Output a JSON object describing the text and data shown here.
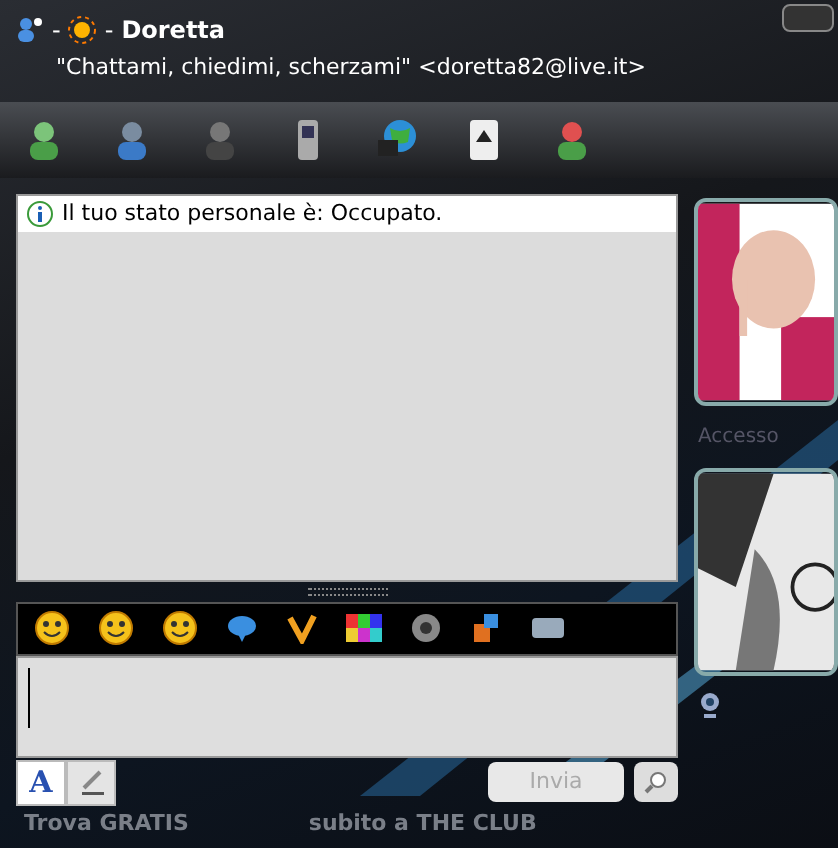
{
  "header": {
    "separator_1": "-",
    "separator_2": "-",
    "name": "Doretta",
    "personal_message": "\"Chattami, chiedimi, scherzami\" <doretta82@live.it>"
  },
  "chat": {
    "status_message": "Il tuo stato personale è: Occupato."
  },
  "compose": {
    "send_button": {
      "label": "Invia",
      "disabled": true
    }
  },
  "format_buttons": [
    {
      "kind": "font",
      "label": "A",
      "selected": true
    },
    {
      "kind": "pen",
      "selected": false
    }
  ],
  "contact_label": "Accesso",
  "ad": {
    "bold": "Trova GRATIS",
    "rest": "subito a THE CLUB"
  }
}
